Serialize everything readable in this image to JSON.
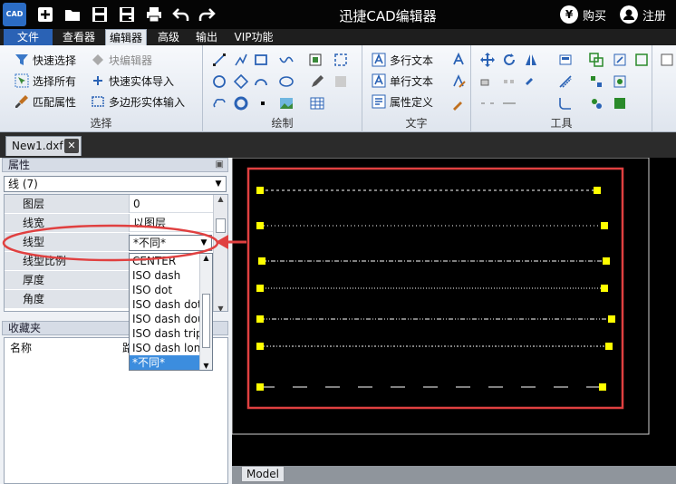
{
  "app": {
    "logo_text": "CAD",
    "title": "迅捷CAD编辑器",
    "buy_label": "购买",
    "register_label": "注册",
    "buy_icon_glyph": "¥"
  },
  "menu": {
    "file": "文件",
    "items": [
      "查看器",
      "编辑器",
      "高级",
      "输出",
      "VIP功能"
    ],
    "active": "编辑器"
  },
  "ribbon": {
    "select_group": {
      "label": "选择",
      "quick_select": "快速选择",
      "select_all": "选择所有",
      "match_props": "匹配属性",
      "block_editor": "块编辑器",
      "quick_entity_import": "快速实体导入",
      "polygon_entity_input": "多边形实体输入"
    },
    "draw_group": {
      "label": "绘制"
    },
    "text_group": {
      "label": "文字",
      "mtext": "多行文本",
      "stext": "单行文本",
      "attdef": "属性定义"
    },
    "tools_group": {
      "label": "工具"
    }
  },
  "doc_tab": {
    "name": "New1.dxf"
  },
  "properties": {
    "header": "属性",
    "object_type": "线 (7)",
    "rows": [
      {
        "name": "图层",
        "value": "0"
      },
      {
        "name": "线宽",
        "value": "以图层"
      },
      {
        "name": "线型",
        "value": ""
      },
      {
        "name": "线型比例",
        "value": ""
      },
      {
        "name": "厚度",
        "value": ""
      },
      {
        "name": "角度",
        "value": ""
      }
    ],
    "linetype_combo_value": "*不同*",
    "linetype_options": [
      "CENTER",
      "ISO dash",
      "ISO dot",
      "ISO dash dot",
      "ISO dash double",
      "ISO dash triple",
      "ISO dash long",
      "*不同*"
    ],
    "selected_option": "*不同*"
  },
  "favorites": {
    "header": "收藏夹",
    "col_name": "名称",
    "col_path": "路"
  },
  "model_tab": "Model",
  "colors": {
    "accent": "#2a62b5",
    "highlight_red": "#e04040",
    "grip_yellow": "#ffff00",
    "selected_option": "#3c8dde"
  }
}
